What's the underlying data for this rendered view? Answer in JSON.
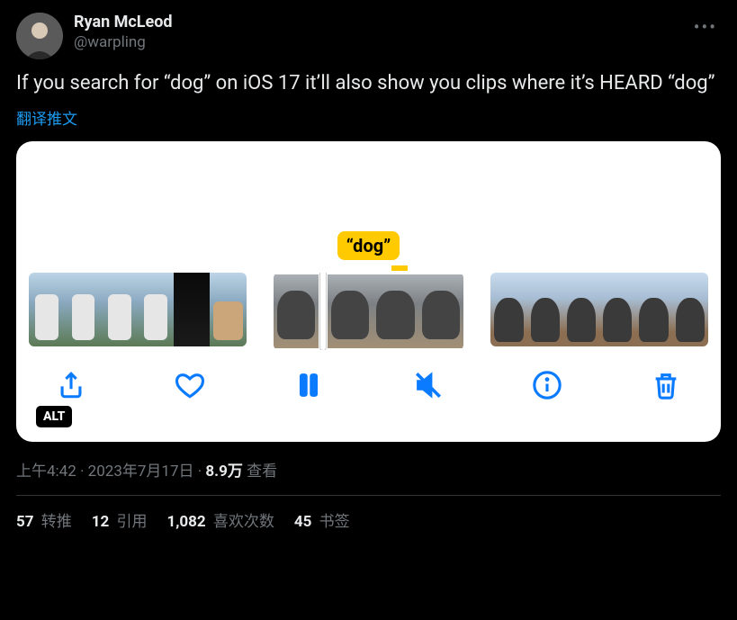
{
  "author": {
    "display_name": "Ryan McLeod",
    "handle": "@warpling"
  },
  "tweet_text": "If you search for “dog” on iOS 17 it’ll also show you clips where it’s HEARD “dog”",
  "translate_label": "翻译推文",
  "screenshot": {
    "search_tag": "“dog”",
    "alt_badge": "ALT"
  },
  "meta": {
    "time": "上午4:42",
    "sep1": " · ",
    "date": "2023年7月17日",
    "sep2": " · ",
    "views_count": "8.9万",
    "views_label": " 查看"
  },
  "stats": {
    "retweets_count": "57",
    "retweets_label": " 转推",
    "quotes_count": "12",
    "quotes_label": " 引用",
    "likes_count": "1,082",
    "likes_label": " 喜欢次数",
    "bookmarks_count": "45",
    "bookmarks_label": " 书签"
  }
}
